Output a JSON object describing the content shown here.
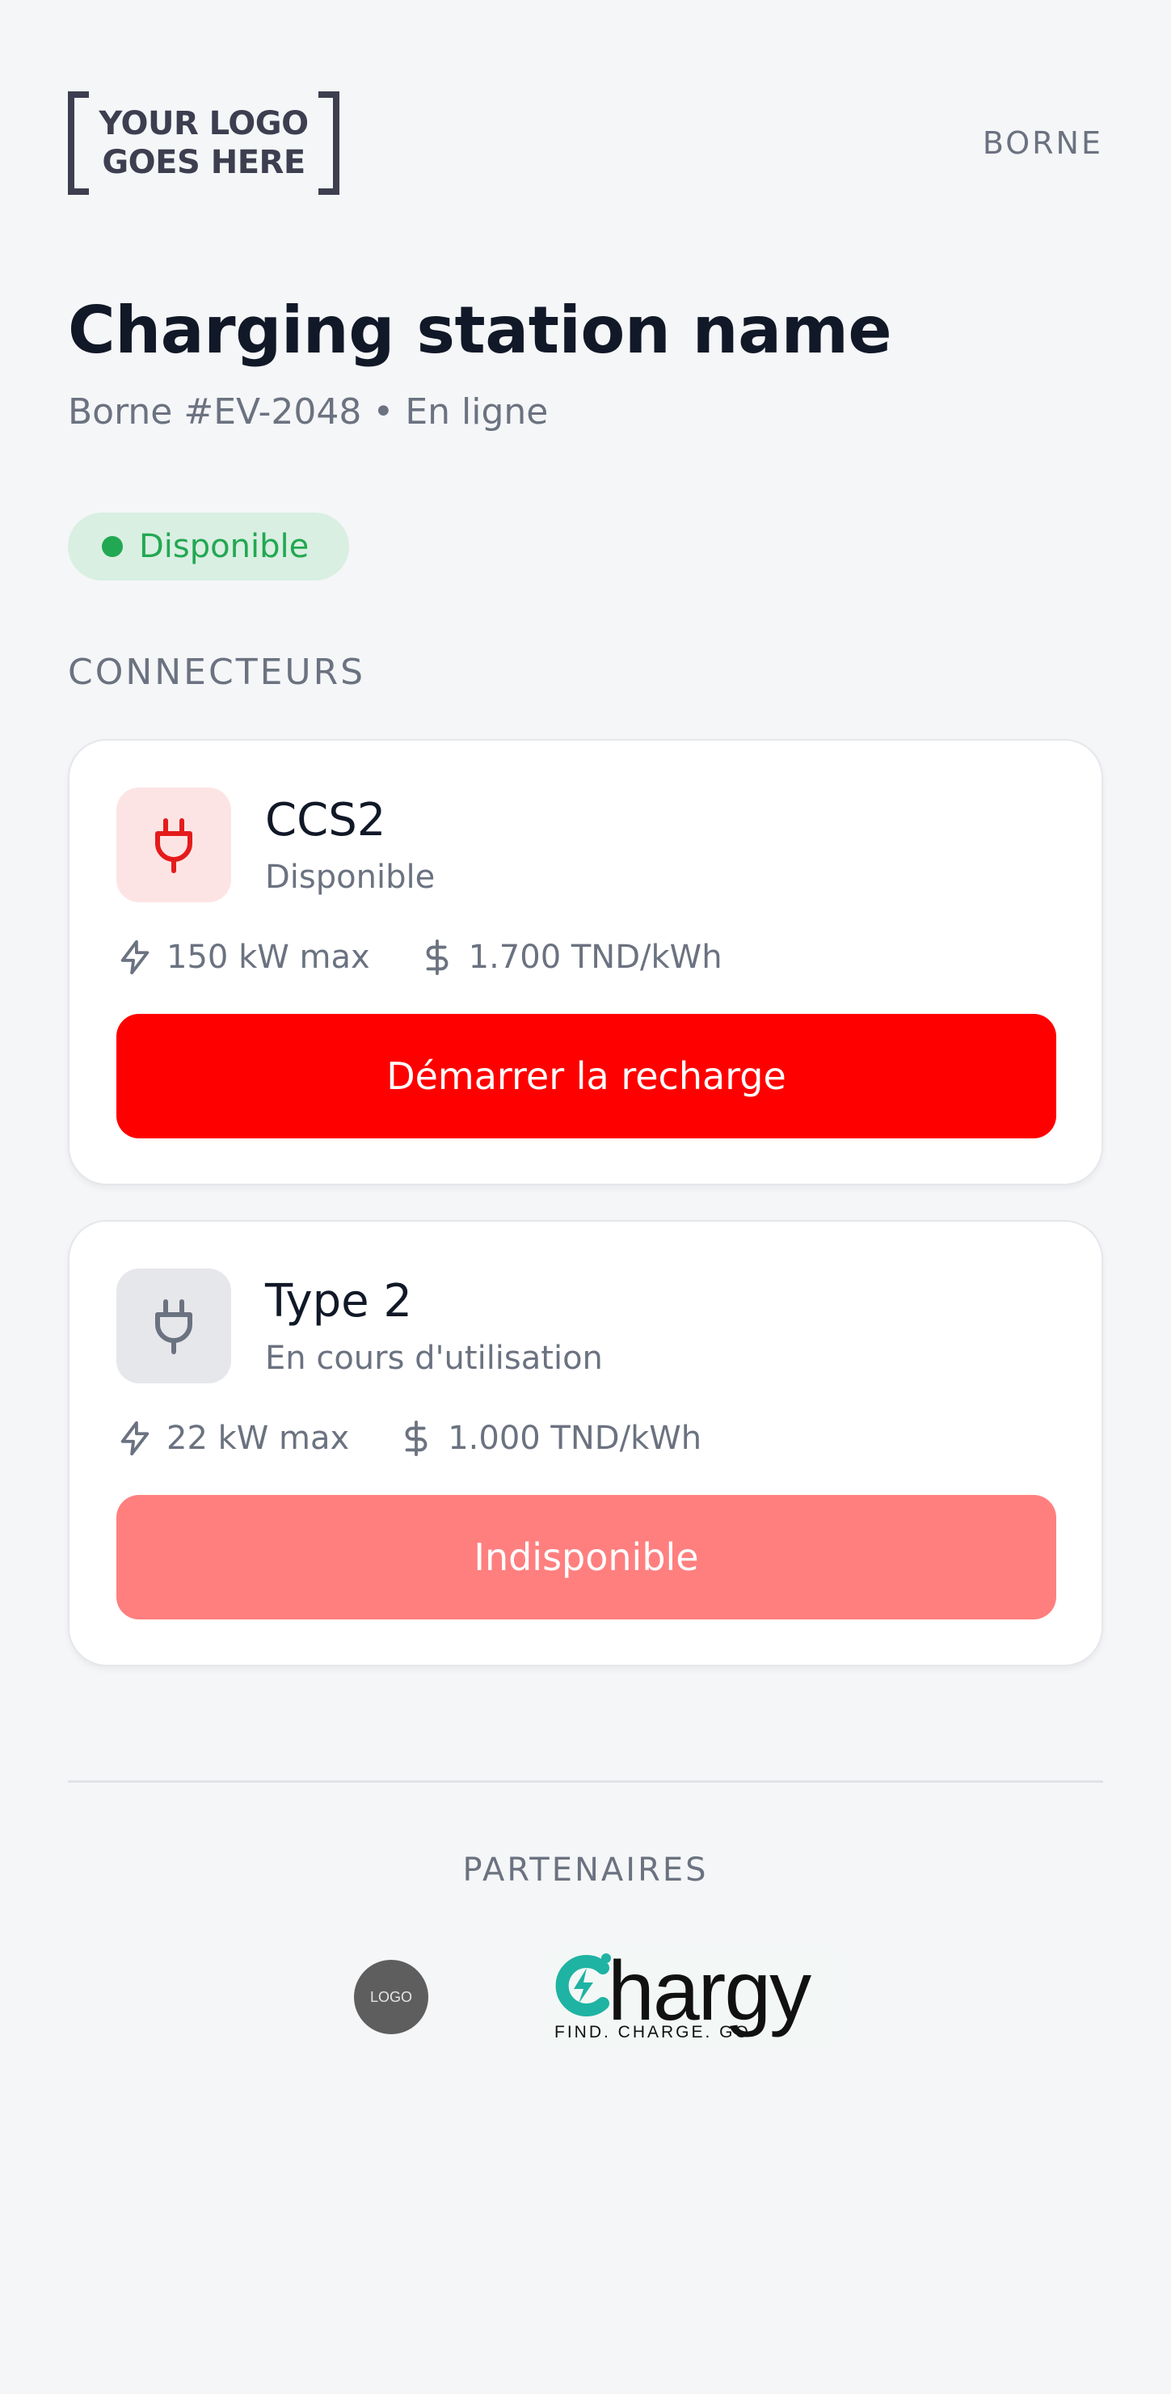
{
  "header": {
    "logo_line1": "YOUR LOGO",
    "logo_line2": "GOES HERE",
    "tag": "BORNE"
  },
  "station": {
    "name": "Charging station name",
    "subtitle": "Borne #EV-2048 • En ligne",
    "status_badge": "Disponible"
  },
  "connectors_label": "CONNECTEURS",
  "connectors": [
    {
      "name": "CCS2",
      "status": "Disponible",
      "power": "150 kW max",
      "price": "1.700 TND/kWh",
      "button_label": "Démarrer la recharge"
    },
    {
      "name": "Type 2",
      "status": "En cours d'utilisation",
      "power": "22 kW max",
      "price": "1.000 TND/kWh",
      "button_label": "Indisponible"
    }
  ],
  "partners": {
    "label": "PARTENAIRES",
    "partner1_text": "LOGO",
    "partner2_word": "hargy",
    "partner2_tagline": "FIND. CHARGE. GO"
  },
  "colors": {
    "accent": "#ff0000",
    "accent_disabled": "#ff7f7f",
    "success": "#22a852",
    "muted": "#6b7280"
  },
  "icons": {
    "connector": "plug-icon",
    "power": "lightning-icon",
    "price": "dollar-icon"
  }
}
